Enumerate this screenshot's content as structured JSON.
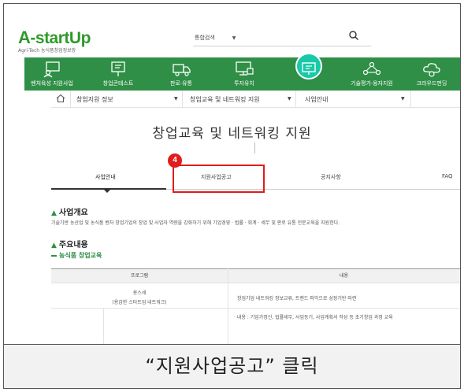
{
  "header": {
    "logo_main": "-startUp",
    "logo_letter": "A",
    "logo_sub": "Agri-Tech 농식품창업정보망",
    "search_select": "통합검색"
  },
  "nav": {
    "items": [
      {
        "label": "벤처육성 지원사업",
        "icon": "person-board-icon"
      },
      {
        "label": "창업콘테스트",
        "icon": "presentation-icon"
      },
      {
        "label": "판로·유통",
        "icon": "truck-icon"
      },
      {
        "label": "투자유치",
        "icon": "monitor-money-icon"
      },
      {
        "label": "",
        "icon": "presentation-screen-icon"
      },
      {
        "label": "기술평가·융자지원",
        "icon": "network-people-icon"
      },
      {
        "label": "크라우드펀딩",
        "icon": "cloud-money-icon"
      }
    ]
  },
  "breadcrumb": {
    "level1": "창업지원 정보",
    "level2": "창업교육 및 네트워킹 지원",
    "level3": "사업안내"
  },
  "page": {
    "title": "창업교육 및 네트워킹 지원"
  },
  "tabs": [
    {
      "label": "사업안내",
      "active": true
    },
    {
      "label": "지원사업공고",
      "active": false
    },
    {
      "label": "공지사항",
      "active": false
    },
    {
      "label": "FAQ",
      "active": false
    }
  ],
  "annotation": {
    "step": "4"
  },
  "overview": {
    "heading": "사업개요",
    "text": "기술기반 농산업 및 농식품 벤처 창업기업의 창업 및 사업자 역량을 강화하기 위해 기업경영 · 법률 · 회계 · 세무 및 판로 유통 전문교육을 지원한다."
  },
  "main": {
    "heading": "주요내용",
    "subheading": "농식품 창업교육"
  },
  "table": {
    "col_program": "프로그램",
    "col_content": "내용",
    "row1_program_line1": "용스세",
    "row1_program_line2": "(용감한 스타트업 네트워크)",
    "row1_content": "창업기업 네트워킹 정보교류, 트렌드 파악으로 성장기반 마련",
    "row2_content": "· 내용 : 기업가정신, 법률세무, 사업등기, 사업계획서 작성 등 초기창업 과정 교육"
  },
  "caption": {
    "text": "“지원사업공고” 클릭"
  },
  "colors": {
    "brand_green": "#2f8f46",
    "accent_teal": "#18c9a8",
    "highlight_red": "#e01c1c",
    "logo_orange": "#e58a17"
  }
}
